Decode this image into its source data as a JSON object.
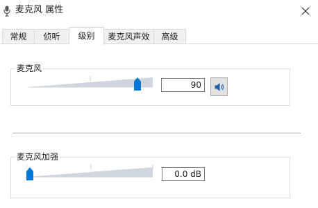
{
  "window": {
    "title": "麦克风 属性",
    "close_icon": "close-icon",
    "app_icon": "microphone-icon"
  },
  "tabs": [
    {
      "label": "常规",
      "active": false
    },
    {
      "label": "侦听",
      "active": false
    },
    {
      "label": "级别",
      "active": true
    },
    {
      "label": "麦克风声效",
      "active": false
    },
    {
      "label": "高级",
      "active": false
    }
  ],
  "microphone": {
    "label": "麦克风",
    "value": "90",
    "level": 90,
    "mute_icon": "speaker-icon"
  },
  "boost": {
    "label": "麦克风加强",
    "value": "0.0 dB",
    "level": 0
  },
  "colors": {
    "accent": "#0078d7",
    "track": "#cfd6de"
  }
}
